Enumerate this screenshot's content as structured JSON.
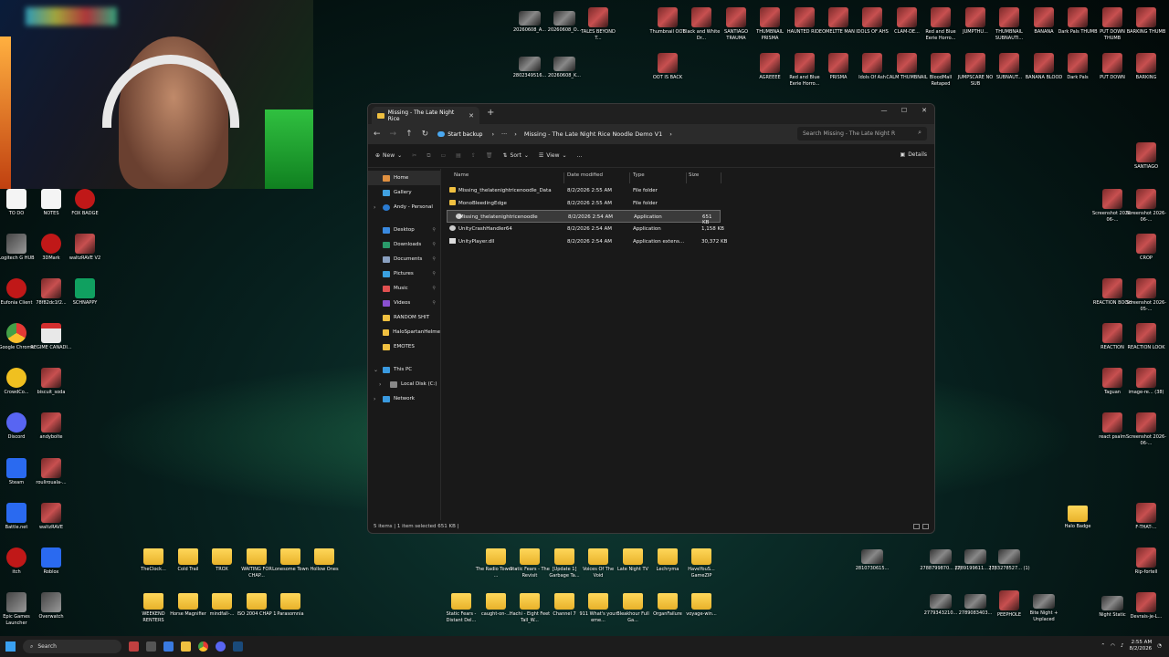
{
  "desktop_top_row1": [
    "20260608_A...",
    "20260608_O...",
    "TALES BEYOND T...",
    "Thumbnail OOT",
    "Black and White Dr...",
    "SANTIAGO TRAUMA",
    "THUMBNAIL PRISMA",
    "HAUNTED RIDE",
    "OMELTTE MAN",
    "IDOLS OF AHS",
    "CLAM-DE...",
    "Red and Blue Eerie Horro...",
    "JUMPTHU...",
    "THUMBNAIL SUBNAUTI...",
    "BANANA",
    "Dark Pals THUMB",
    "PUT DOWN THUMB",
    "BARKING THUMB"
  ],
  "desktop_top_row2": [
    "2802349516...",
    "20260608_K...",
    "OOT IS BACK",
    "AGREEEE",
    "Red and Blue Eerie Horro...",
    "PRISMA",
    "Idols Of Ash",
    "CALM THUMBNAIL",
    "BloodMall Retaped",
    "JUMPSCARE NO SUB",
    "SUBNAUT...",
    "BANANA BLOOD",
    "Dark Pals",
    "PUT DOWN",
    "BARKING"
  ],
  "desktop_left": [
    "TO DO",
    "NOTES",
    "FOX BADGE",
    "Logitech G HUB",
    "3DMark",
    "waltzRAVE V2",
    "Eufonia Client",
    "78f82dc1f2...",
    "SCHNAPPY",
    "Google Chrome",
    "REGIME CANADI...",
    "CrowdCo...",
    "biscuit_soda",
    "Discord",
    "andybolte",
    "Steam",
    "roulirouala-...",
    "Battle.net",
    "waltzRAVE",
    "itch",
    "Roblox",
    "Epic Games Launcher",
    "Overwatch"
  ],
  "desktop_right": [
    "SANTIAGO",
    "Screenshot 2026-06-...",
    "Screenshot 2026-06-...",
    "CROP",
    "REACTION BOOH",
    "Screenshot 2026-05-...",
    "REACTION",
    "REACTION LOOK",
    "Taguan",
    "image-re... (38)",
    "react psalm",
    "Screenshot 2026-06-...",
    "Halo Badge",
    "F-THAT-...",
    "Rip-fortell",
    "Night Static",
    "Devrais-je-L..."
  ],
  "desktop_bottom_row1": [
    "TheClock...",
    "Cold Trail",
    "TROX",
    "WAITING FOR CHAP...",
    "Lonesome Town",
    "Hollow Ones",
    "The Radio Tower - ...",
    "Static Fears - The Revisit",
    "[Update 1] Garbage Ta...",
    "Voices Of The Void",
    "Late Night TV",
    "Lechryma",
    "HaveYouS... GameZIP",
    "2810730615...",
    "2788799870... (1)",
    "2789199611... (1)",
    "2783278527... (1)"
  ],
  "desktop_bottom_row2": [
    "WEEKEND RENTERS",
    "Horse Magnifier",
    "mindfall-...",
    "ISO 2004 CHAP 1",
    "Parasomnia",
    "Static Fears - Distant Del...",
    "caught-on-...",
    "Hachi - Eight Feet Tall_W...",
    "Channel 7",
    "911 What's your eme...",
    "Bleakhour Full Ga...",
    "OrganFailure",
    "voyage-win...",
    "2779343210...",
    "2789083403...",
    "PEEPHOLE",
    "Bite Night + Unplaced"
  ],
  "explorer": {
    "tab_title": "Missing - The Late Night Rice",
    "backup_label": "Start backup",
    "breadcrumb": "Missing - The Late Night Rice Noodle Demo V1",
    "search_placeholder": "Search Missing - The Late Night R",
    "toolbar": {
      "new": "New",
      "sort": "Sort",
      "view": "View",
      "more": "...",
      "details": "Details"
    },
    "sidebar": {
      "home": "Home",
      "gallery": "Gallery",
      "personal": "Andy - Personal",
      "desktop": "Desktop",
      "downloads": "Downloads",
      "documents": "Documents",
      "pictures": "Pictures",
      "music": "Music",
      "videos": "Videos",
      "random": "RANDOM SHIT",
      "halo": "HaloSpartanHelme",
      "emotes": "EMOTES",
      "thispc": "This PC",
      "localdisk": "Local Disk (C:)",
      "network": "Network"
    },
    "columns": {
      "name": "Name",
      "date": "Date modified",
      "type": "Type",
      "size": "Size"
    },
    "files": [
      {
        "name": "Missing_thelatenightricenoodle_Data",
        "date": "8/2/2026 2:55 AM",
        "type": "File folder",
        "size": ""
      },
      {
        "name": "MonoBleedingEdge",
        "date": "8/2/2026 2:55 AM",
        "type": "File folder",
        "size": ""
      },
      {
        "name": "Missing_thelatenightricenoodle",
        "date": "8/2/2026 2:54 AM",
        "type": "Application",
        "size": "651 KB"
      },
      {
        "name": "UnityCrashHandler64",
        "date": "8/2/2026 2:54 AM",
        "type": "Application",
        "size": "1,158 KB"
      },
      {
        "name": "UnityPlayer.dll",
        "date": "8/2/2026 2:54 AM",
        "type": "Application extens...",
        "size": "30,372 KB"
      }
    ],
    "status": "5 items  |  1 item selected  651 KB  |"
  },
  "taskbar": {
    "search": "Search",
    "time": "2:55 AM",
    "date": "8/2/2026"
  }
}
